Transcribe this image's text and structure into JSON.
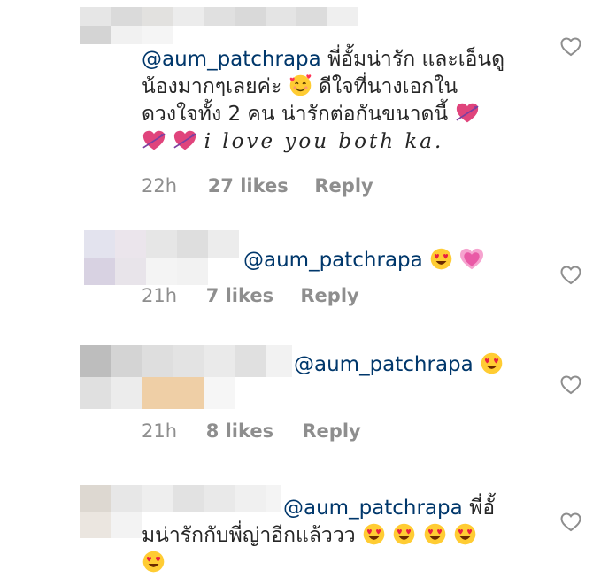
{
  "comments": [
    {
      "mention": "@aum_patchrapa",
      "lines": [
        "พี่อั้มน่ารัก และเอ็นดู",
        "น้องมากๆเลยค่ะ",
        "ดีใจที่นางเอกใน",
        "ดวงใจทั้ง 2 คน น่ารักต่อกันขนาดนี้",
        "i love you both ka."
      ],
      "time": "22h",
      "likes": "27 likes",
      "reply": "Reply",
      "emojis": [
        "smiling-face-with-hearts",
        "heart-with-arrow",
        "heart-with-arrow",
        "heart-with-arrow"
      ]
    },
    {
      "mention": "@aum_patchrapa",
      "time": "21h",
      "likes": "7 likes",
      "reply": "Reply",
      "emojis": [
        "heart-eyes",
        "growing-heart"
      ]
    },
    {
      "mention": "@aum_patchrapa",
      "time": "21h",
      "likes": "8 likes",
      "reply": "Reply",
      "emojis": [
        "heart-eyes"
      ]
    },
    {
      "mention": "@aum_patchrapa",
      "lines": [
        "พี่อั้",
        "มน่ารักกับพี่ญ่าอีกแล้ววว"
      ],
      "emojis": [
        "heart-eyes",
        "heart-eyes",
        "heart-eyes",
        "heart-eyes",
        "heart-eyes"
      ]
    }
  ],
  "colors": {
    "mention": "#00376b",
    "text": "#262626",
    "meta": "#8e8e8e",
    "heart_outline": "#8e8e8e"
  },
  "icons": {
    "like": "heart-outline-icon"
  }
}
